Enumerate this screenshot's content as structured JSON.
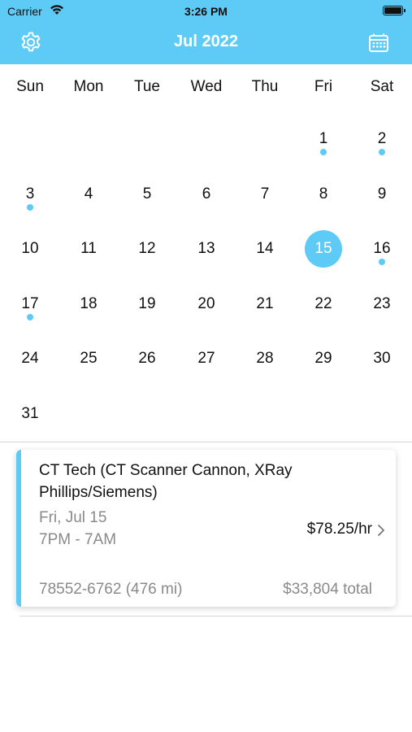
{
  "status_bar": {
    "carrier": "Carrier",
    "time": "3:26 PM"
  },
  "nav": {
    "title": "Jul 2022",
    "left_icon": "gear-icon",
    "right_icon": "calendar-icon"
  },
  "weekdays": [
    "Sun",
    "Mon",
    "Tue",
    "Wed",
    "Thu",
    "Fri",
    "Sat"
  ],
  "calendar": {
    "days": [
      "1",
      "2",
      "3",
      "4",
      "5",
      "6",
      "7",
      "8",
      "9",
      "10",
      "11",
      "12",
      "13",
      "14",
      "15",
      "16",
      "17",
      "18",
      "19",
      "20",
      "21",
      "22",
      "23",
      "24",
      "25",
      "26",
      "27",
      "28",
      "29",
      "30",
      "31"
    ],
    "selected_day": "15",
    "days_with_events": [
      "1",
      "2",
      "3",
      "16",
      "17"
    ]
  },
  "shift_card": {
    "title": "CT Tech (CT Scanner Cannon, XRay Phillips/Siemens)",
    "date": "Fri, Jul 15",
    "hours": "7PM - 7AM",
    "rate": "$78.25/hr",
    "location": "78552-6762 (476 mi)",
    "total": "$33,804 total"
  },
  "colors": {
    "accent": "#5ecbf6",
    "secondary_text": "#8a8a8a"
  }
}
